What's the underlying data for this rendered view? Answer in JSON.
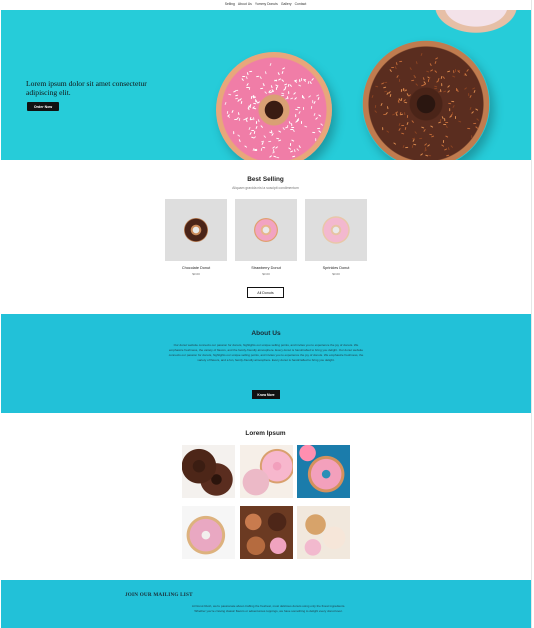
{
  "nav": {
    "items": [
      "Selling",
      "About Us",
      "Yummy Donuts",
      "Gallery",
      "Contact"
    ]
  },
  "hero": {
    "title": "Lorem ipsum dolor sit amet consectetur adipiscing elit.",
    "button": "Order Now"
  },
  "best_selling": {
    "title": "Best Selling",
    "subtitle": "Aliquam gravida nisi a suscipit condimentum",
    "products": [
      {
        "name": "Chocolate Donut",
        "price": "$3.00",
        "icing": "#4a2418"
      },
      {
        "name": "Strawberry Donut",
        "price": "$3.00",
        "icing": "#f2a3c2"
      },
      {
        "name": "Sprinkles Donut",
        "price": "$3.00",
        "icing": "#f3b8cf"
      }
    ],
    "button": "All Donuts"
  },
  "about": {
    "title": "About Us",
    "body": "Our donut website connects our passion for donuts, highlights our unique selling points, and invites you to experience the joy of donuts. We emphasize freshness, the variety of flavors, and the family-friendly atmosphere. Every donut is handcrafted to bring you delight. Our donut website connects our passion for donuts, highlights our unique selling points, and invites you to experience the joy of donuts. We emphasize freshness, the variety of flavors, and a fun, family-friendly atmosphere. Every donut is handcrafted to bring you delight.",
    "button": "Know More"
  },
  "gallery": {
    "title": "Lorem Ipsum"
  },
  "mailing": {
    "title": "JOIN OUR MAILING LIST",
    "body": "At Donut Rush, we're passionate about crafting the freshest, most delicious donuts using only the finest ingredients. Whether you're craving classic flavors or adventurous toppings, we have something to delight every donut lover."
  },
  "colors": {
    "accent": "#22c1d8",
    "hero_bg": "#26ccd9",
    "button": "#111111"
  }
}
